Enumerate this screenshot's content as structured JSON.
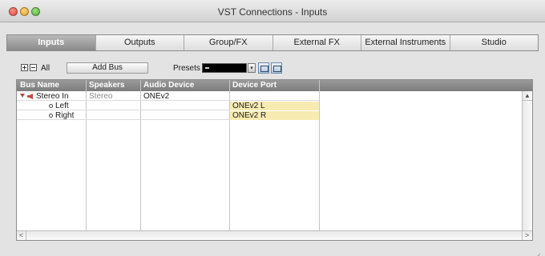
{
  "window": {
    "title": "VST Connections - Inputs"
  },
  "tabs": [
    "Inputs",
    "Outputs",
    "Group/FX",
    "External FX",
    "External Instruments",
    "Studio"
  ],
  "active_tab": "Inputs",
  "toolbar": {
    "all_label": "All",
    "add_bus_label": "Add Bus",
    "presets_label": "Presets",
    "presets_value": ""
  },
  "table": {
    "columns": [
      "Bus Name",
      "Speakers",
      "Audio Device",
      "Device Port"
    ],
    "rows": [
      {
        "bus_name": "Stereo In",
        "speakers": "Stereo",
        "audio_device": "ONEv2",
        "device_port": ""
      },
      {
        "bus_name": "Left",
        "speakers": "",
        "audio_device": "",
        "device_port": "ONEv2 L"
      },
      {
        "bus_name": "Right",
        "speakers": "",
        "audio_device": "",
        "device_port": "ONEv2 R"
      }
    ]
  },
  "icons": {
    "expand_all": "plus-square-icon",
    "collapse_all": "minus-square-icon",
    "bus_expander": "triangle-down-icon",
    "bus_type": "speaker-icon",
    "channel": "channel-dot-icon",
    "preset_save": "preset-save-icon",
    "preset_delete": "preset-delete-icon"
  },
  "colors": {
    "port_highlight": "#f8ebb1",
    "speaker_red": "#c14a3a",
    "active_tab": "#8a8a8a"
  }
}
